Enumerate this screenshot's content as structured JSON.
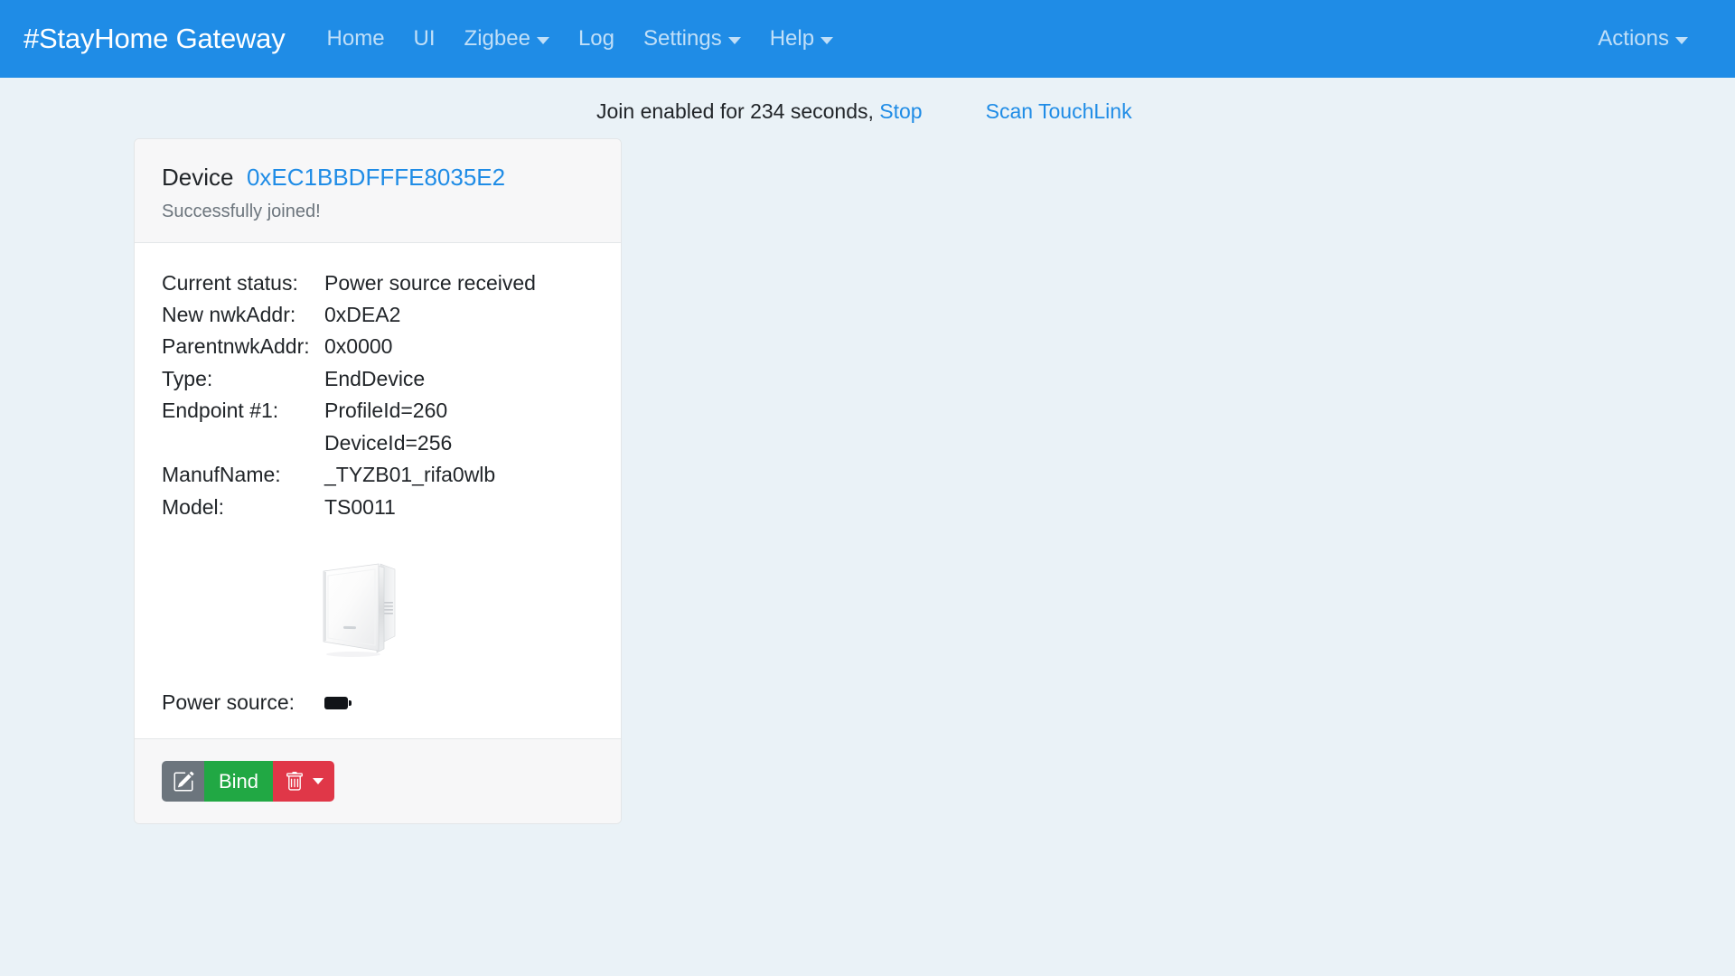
{
  "navbar": {
    "brand": "#StayHome Gateway",
    "items": [
      {
        "label": "Home",
        "dropdown": false,
        "icon": ""
      },
      {
        "label": "UI",
        "dropdown": false,
        "icon": ""
      },
      {
        "label": "Zigbee",
        "dropdown": true,
        "icon": "chevron-down-icon"
      },
      {
        "label": "Log",
        "dropdown": false,
        "icon": ""
      },
      {
        "label": "Settings",
        "dropdown": true,
        "icon": "chevron-down-icon"
      },
      {
        "label": "Help",
        "dropdown": true,
        "icon": "chevron-down-icon"
      }
    ],
    "actions_label": "Actions",
    "background_color": "#1f8ce6",
    "brand_color": "#ffffff",
    "link_color": "rgba(255,255,255,0.72)"
  },
  "status": {
    "join_text": "Join enabled for 234 seconds,",
    "join_seconds": "234",
    "stop_label": "Stop",
    "scan_touchlink_label": "Scan TouchLink",
    "link_color": "#1f8ce6"
  },
  "card": {
    "header": {
      "title_prefix": "Device",
      "device_id": "0xEC1BBDFFFE8035E2",
      "subtitle": "Successfully joined!"
    },
    "rows": [
      {
        "key": "Current status:",
        "value": "Power source received"
      },
      {
        "key": "New nwkAddr:",
        "value": "0xDEA2"
      },
      {
        "key": "ParentnwkAddr:",
        "value": "0x0000"
      },
      {
        "key": "Type:",
        "value": "EndDevice"
      },
      {
        "key": "Endpoint #1:",
        "value": "ProfileId=260"
      },
      {
        "key": "",
        "value": "DeviceId=256"
      },
      {
        "key": "ManufName:",
        "value": "_TYZB01_rifa0wlb"
      },
      {
        "key": "Model:",
        "value": "TS0011"
      }
    ],
    "device_image_alt": "white-wall-switch-photo",
    "power": {
      "label": "Power source:",
      "icon": "battery-full-icon"
    },
    "footer": {
      "edit_icon": "pencil-square-icon",
      "edit_label": "",
      "bind_label": "Bind",
      "delete_icon": "trash-icon",
      "delete_caret_icon": "chevron-down-icon",
      "edit_color": "#6c757d",
      "bind_color": "#21a844",
      "delete_color": "#e03748"
    }
  },
  "theme": {
    "page_background": "#eaf2f7",
    "card_background": "#ffffff",
    "card_header_background": "#f7f7f8",
    "border_color": "#e3e6e8",
    "muted_text": "#6c757d"
  }
}
